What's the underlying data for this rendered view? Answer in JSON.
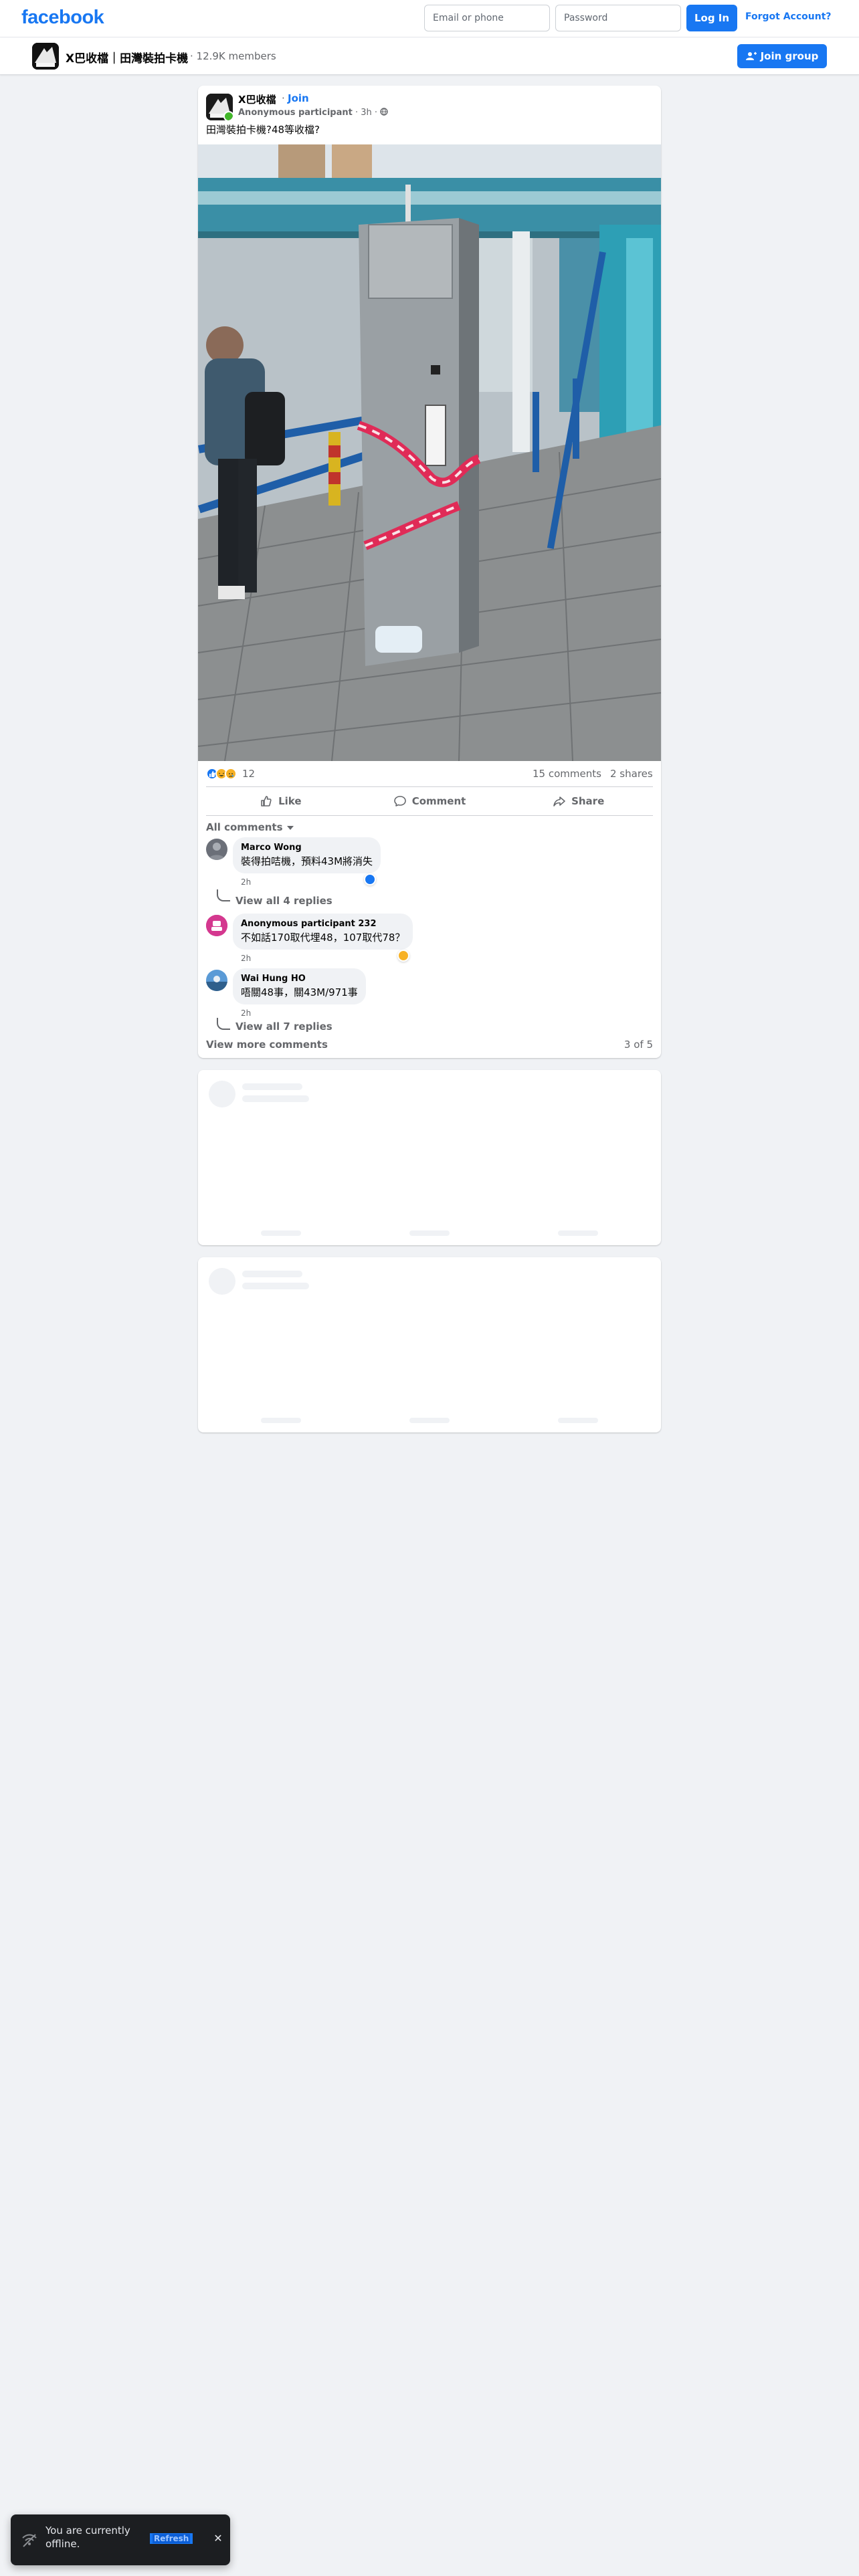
{
  "topbar": {
    "logo": "facebook",
    "email_placeholder": "Email or phone",
    "password_placeholder": "Password",
    "login_label": "Log In",
    "forgot_label": "Forgot Account?"
  },
  "group": {
    "name": "X巴收檔｜田灣裝拍卡機",
    "members": "· 12.9K members",
    "join_label": "Join group"
  },
  "post": {
    "group_name": "X巴收檔",
    "dot": "·",
    "join_label": "Join",
    "author": "Anonymous participant",
    "time": "· 3h ·",
    "text": "田灣裝拍卡機?48等收檔?",
    "reaction_count": "12",
    "comments_count": "15 comments",
    "shares_count": "2 shares",
    "actions": {
      "like": "Like",
      "comment": "Comment",
      "share": "Share"
    },
    "all_comments_label": "All comments",
    "comments": [
      {
        "name": "Marco Wong",
        "text": "裝得拍咭機，預料43M將消失",
        "time": "2h",
        "replies": "View all 4 replies"
      },
      {
        "name": "Anonymous participant 232",
        "text": "不如話170取代埋48，107取代78？",
        "time": "2h"
      },
      {
        "name": "Wai Hung HO",
        "text": "唔關48事，關43M/971事",
        "time": "2h",
        "replies": "View all 7 replies"
      }
    ],
    "view_more": "View more comments",
    "pager": "3 of 5"
  },
  "toast": {
    "text": "You are currently offline.",
    "refresh": "Refresh"
  },
  "colors": {
    "brand": "#1877f2",
    "background": "#f0f2f5"
  },
  "icons": [
    "like-icon",
    "comment-icon",
    "share-icon",
    "join-group-icon",
    "offline-icon",
    "close-icon",
    "globe-icon"
  ]
}
